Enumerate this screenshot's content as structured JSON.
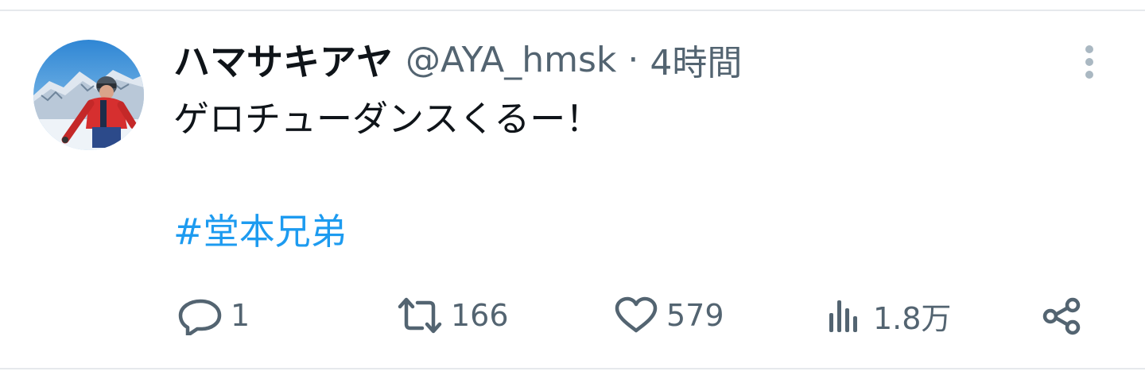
{
  "tweet": {
    "display_name": "ハマサキアヤ",
    "handle": "@AYA_hmsk",
    "separator": "·",
    "time": "4時間",
    "text": "ゲロチューダンスくるー！",
    "hashtag": "#堂本兄弟"
  },
  "actions": {
    "reply_count": "1",
    "retweet_count": "166",
    "like_count": "579",
    "views_count": "1.8万"
  },
  "icons": {
    "reply": "reply-icon",
    "retweet": "retweet-icon",
    "like": "heart-icon",
    "views": "views-icon",
    "share": "share-icon",
    "more": "more-vertical-icon"
  },
  "colors": {
    "text_primary": "#0f1419",
    "text_secondary": "#536471",
    "hashtag": "#1d9bf0",
    "divider": "#e6e9ec"
  }
}
